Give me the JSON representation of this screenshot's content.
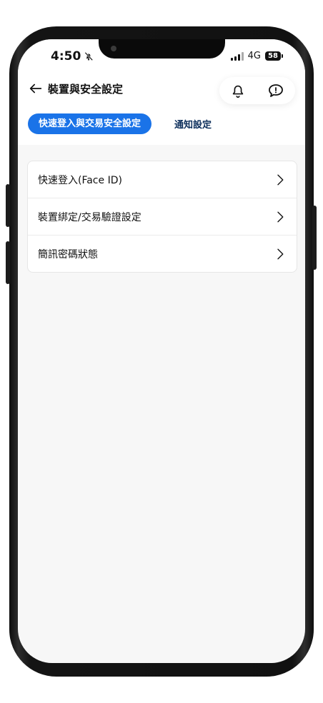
{
  "status_bar": {
    "time": "4:50",
    "network": "4G",
    "battery": "58"
  },
  "header": {
    "title": "裝置與安全設定"
  },
  "tabs": [
    {
      "label": "快速登入與交易安全設定",
      "active": true
    },
    {
      "label": "通知設定",
      "active": false
    }
  ],
  "settings": [
    {
      "label": "快速登入(Face ID)"
    },
    {
      "label": "裝置綁定/交易驗證設定"
    },
    {
      "label": "簡訊密碼狀態"
    }
  ],
  "colors": {
    "accent": "#1a73e8",
    "tab_text": "#0d2f5c",
    "background": "#f7f7f7"
  },
  "icons": {
    "back": "arrow-left-icon",
    "notification": "bell-icon",
    "chat": "chat-bubble-icon",
    "row": "chevron-right-icon",
    "mute": "bell-slash-icon"
  }
}
